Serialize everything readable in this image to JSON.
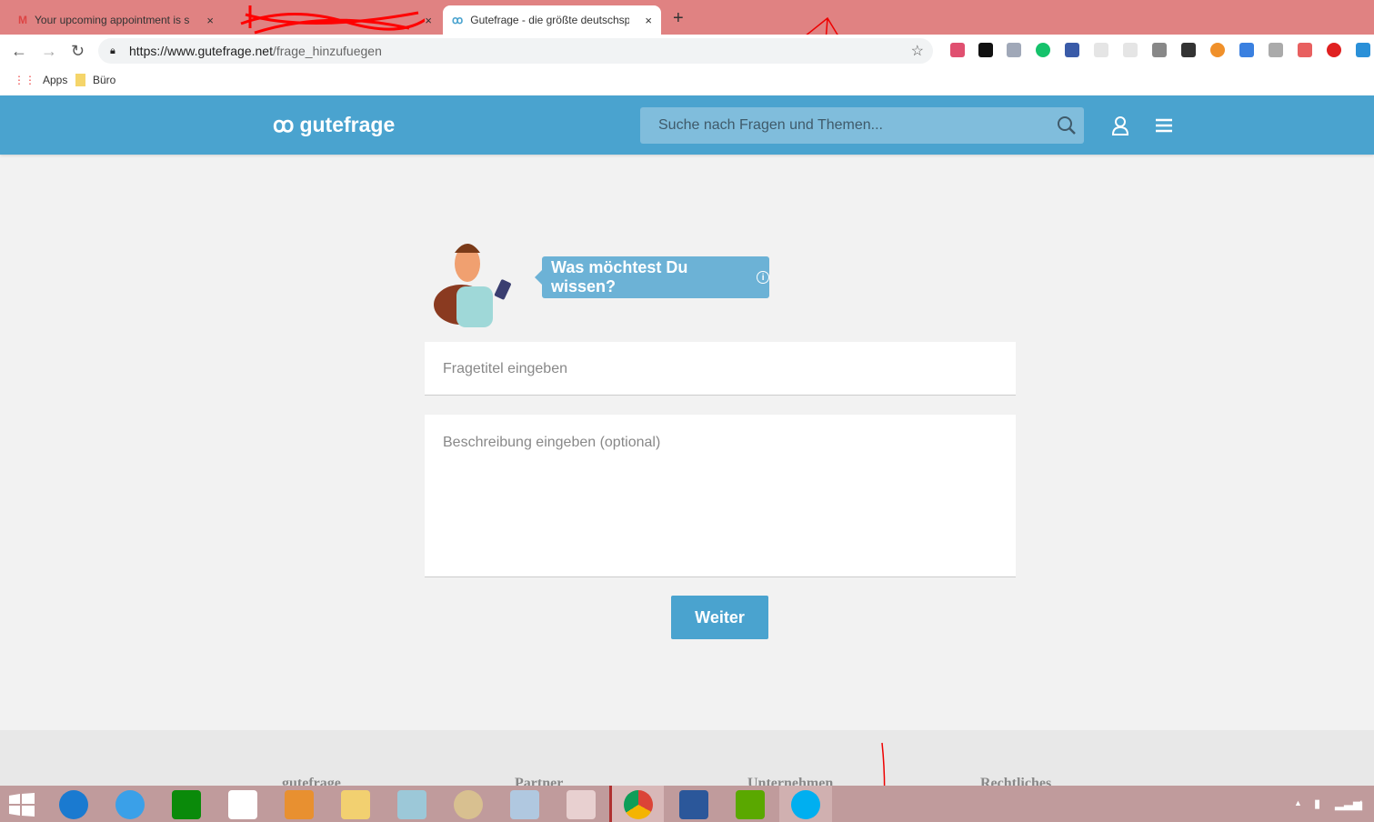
{
  "browser": {
    "tabs": [
      {
        "title": "Your upcoming appointment is s",
        "icon": "gmail-icon"
      },
      {
        "title": "",
        "icon": "redacted-tab-icon"
      },
      {
        "title": "Gutefrage - die größte deutschsp",
        "icon": "gutefrage-icon",
        "active": true
      }
    ],
    "new_tab": "+",
    "close": "×",
    "url_host": "https://www.gutefrage.net",
    "url_path": "/frage_hinzufuegen",
    "bookmarks": [
      {
        "label": "Apps",
        "icon": "apps-grid-icon"
      },
      {
        "label": "Büro",
        "icon": "folder-icon"
      }
    ],
    "extensions": [
      "eyedropper",
      "ninja",
      "code",
      "grammarly",
      "bookmark",
      "price-search",
      "tv",
      "arrow",
      "download",
      "logo-blue-orange",
      "tag",
      "qr",
      "shield",
      "adblock",
      "blue-square"
    ]
  },
  "site": {
    "logo": "gutefrage",
    "search_placeholder": "Suche nach Fragen und Themen...",
    "prompt": "Was möchtest Du wissen?",
    "title_placeholder": "Fragetitel eingeben",
    "description_placeholder": "Beschreibung eingeben (optional)",
    "submit": "Weiter",
    "footer": [
      "gutefrage",
      "Partner",
      "Unternehmen",
      "Rechtliches"
    ],
    "accent": "#4aa3cf"
  },
  "taskbar": {
    "apps": [
      "start",
      "thunderbird",
      "internet-explorer",
      "store",
      "dropbox",
      "media-player",
      "file-explorer",
      "notes",
      "paint",
      "calculator",
      "snipping-tool",
      "chrome",
      "word",
      "camtasia",
      "skype"
    ]
  }
}
